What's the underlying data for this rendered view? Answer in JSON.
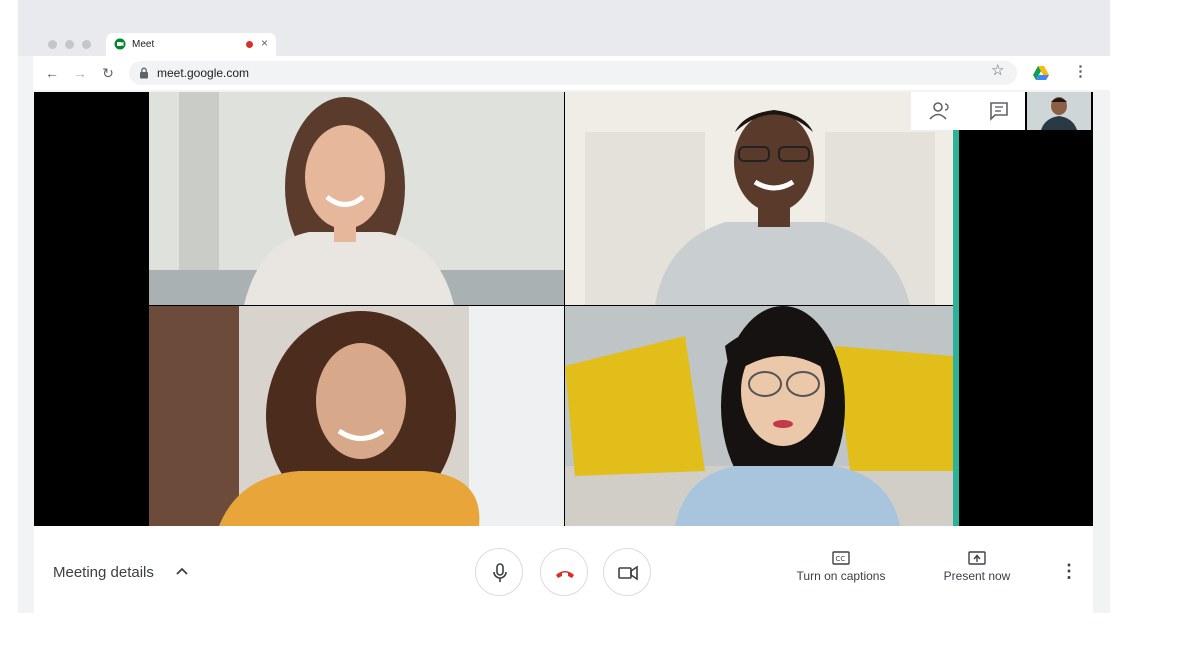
{
  "browser": {
    "tab": {
      "title": "Meet",
      "close": "×"
    },
    "nav": {
      "back": "←",
      "forward": "→",
      "reload": "↻"
    },
    "address": {
      "url": "meet.google.com"
    },
    "toolbar_icons": {
      "star": "☆",
      "drive": "drive-icon",
      "menu": "⋮"
    }
  },
  "meeting": {
    "participants": [
      {
        "name": "participant-1",
        "shirt": "#e9e6e2",
        "bg": "#d9dcd7",
        "skin": "#e6b79b",
        "hair": "#5a3b2c"
      },
      {
        "name": "participant-2",
        "shirt": "#c9cfd0",
        "bg": "#ecebe4",
        "skin": "#5a3a2a",
        "hair": "#1c1410"
      },
      {
        "name": "participant-3",
        "shirt": "#e8a53a",
        "bg": "#cfcac3",
        "skin": "#d7a98a",
        "hair": "#4b2c1d"
      },
      {
        "name": "participant-4",
        "shirt": "#a8c5dd",
        "bg": "#c8c4b7",
        "skin": "#ecc8aa",
        "hair": "#161212"
      }
    ],
    "accent": "#2bb39a"
  },
  "controls": {
    "meeting_details": "Meeting details",
    "captions_label": "Turn on captions",
    "present_label": "Present now",
    "more": "⋮",
    "hangup_color": "#d93025"
  }
}
